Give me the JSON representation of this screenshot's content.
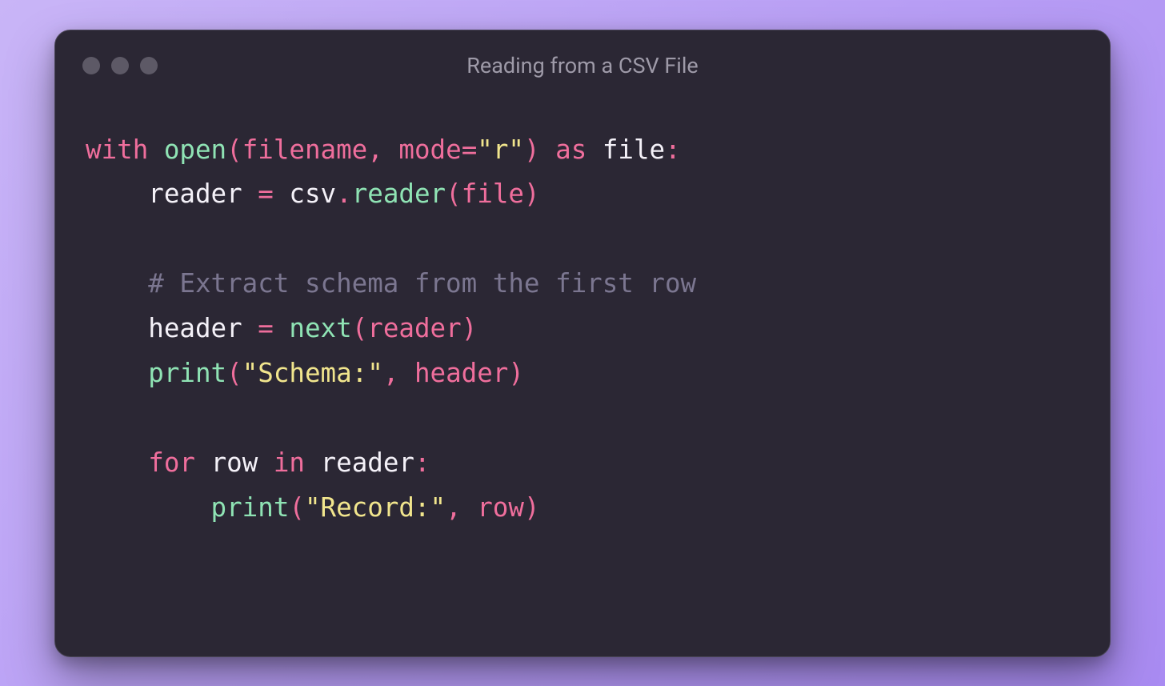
{
  "window": {
    "title": "Reading from a CSV File"
  },
  "code": {
    "l1": {
      "kw_with": "with",
      "fn_open": "open",
      "paren_o": "(",
      "arg_filename": "filename",
      "comma1": ",",
      "arg_mode": "mode",
      "eq": "=",
      "str_r": "\"r\"",
      "paren_c": ")",
      "kw_as": "as",
      "var_file": "file",
      "colon": ":"
    },
    "l2": {
      "var_reader": "reader",
      "eq": "=",
      "var_csv": "csv",
      "dot": ".",
      "fn_reader": "reader",
      "paren_o": "(",
      "arg_file": "file",
      "paren_c": ")"
    },
    "l4": {
      "comment": "# Extract schema from the first row"
    },
    "l5": {
      "var_header": "header",
      "eq": "=",
      "fn_next": "next",
      "paren_o": "(",
      "arg_reader": "reader",
      "paren_c": ")"
    },
    "l6": {
      "fn_print": "print",
      "paren_o": "(",
      "str_schema": "\"Schema:\"",
      "comma": ",",
      "arg_header": "header",
      "paren_c": ")"
    },
    "l8": {
      "kw_for": "for",
      "var_row": "row",
      "kw_in": "in",
      "var_reader": "reader",
      "colon": ":"
    },
    "l9": {
      "fn_print": "print",
      "paren_o": "(",
      "str_record": "\"Record:\"",
      "comma": ",",
      "arg_row": "row",
      "paren_c": ")"
    }
  }
}
